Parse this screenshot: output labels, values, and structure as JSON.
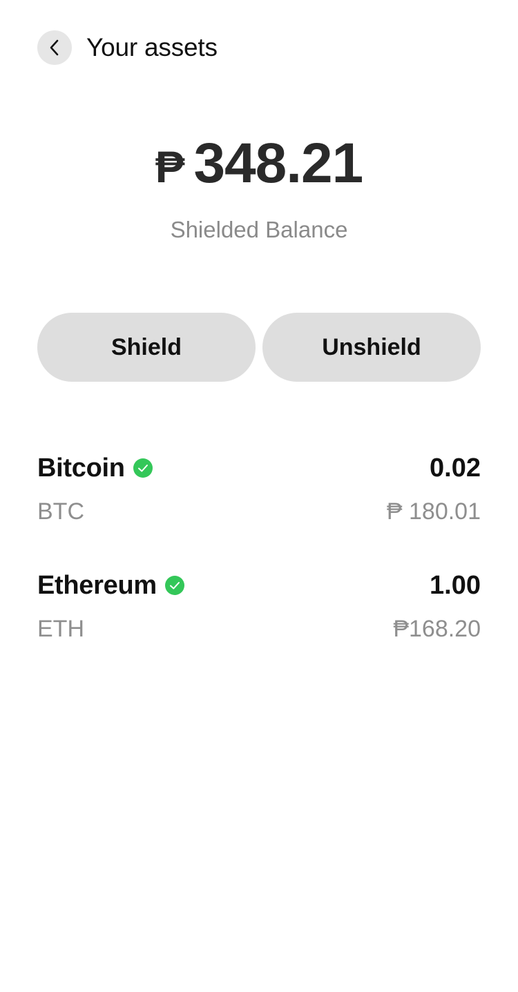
{
  "header": {
    "title": "Your assets",
    "back_icon": "chevron-left-icon"
  },
  "balance": {
    "currency": "₱",
    "amount": "348.21",
    "label": "Shielded Balance"
  },
  "actions": {
    "shield_label": "Shield",
    "unshield_label": "Unshield"
  },
  "assets": [
    {
      "name": "Bitcoin",
      "symbol": "BTC",
      "quantity": "0.02",
      "value": "₱ 180.01",
      "verified": true
    },
    {
      "name": "Ethereum",
      "symbol": "ETH",
      "quantity": "1.00",
      "value": "₱168.20",
      "verified": true
    }
  ],
  "colors": {
    "verified": "#34c759",
    "button_bg": "#dedede",
    "muted_text": "#8e8e8e"
  }
}
